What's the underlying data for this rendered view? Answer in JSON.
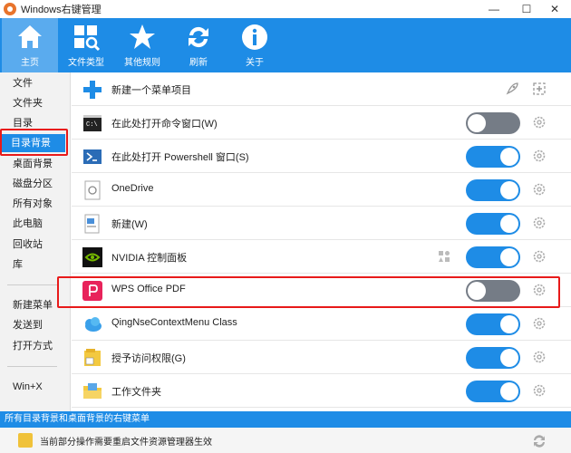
{
  "app": {
    "title": "Windows右键管理"
  },
  "window_controls": {
    "minimize": "—",
    "maximize": "☐",
    "close": "✕"
  },
  "toolbar": [
    {
      "name": "home",
      "label": "主页",
      "icon": "home-icon",
      "active": true
    },
    {
      "name": "file-types",
      "label": "文件类型",
      "icon": "file-types-icon",
      "active": false
    },
    {
      "name": "other-rules",
      "label": "其他规则",
      "icon": "star-icon",
      "active": false
    },
    {
      "name": "refresh",
      "label": "刷新",
      "icon": "refresh-icon",
      "active": false
    },
    {
      "name": "about",
      "label": "关于",
      "icon": "info-icon",
      "active": false
    }
  ],
  "sidebar": {
    "items": [
      {
        "label": "文件"
      },
      {
        "label": "文件夹"
      },
      {
        "label": "目录"
      },
      {
        "label": "目录背景",
        "selected": true
      },
      {
        "label": "桌面背景"
      },
      {
        "label": "磁盘分区"
      },
      {
        "label": "所有对象"
      },
      {
        "label": "此电脑"
      },
      {
        "label": "回收站"
      },
      {
        "label": "库"
      },
      {
        "label": "新建菜单"
      },
      {
        "label": "发送到"
      },
      {
        "label": "打开方式"
      },
      {
        "label": "Win+X"
      }
    ]
  },
  "main": {
    "new_item": {
      "label": "新建一个菜单项目"
    },
    "rows": [
      {
        "label": "在此处打开命令窗口(W)",
        "icon": "cmd-icon",
        "enabled": false
      },
      {
        "label": "在此处打开 Powershell 窗口(S)",
        "icon": "powershell-icon",
        "enabled": true
      },
      {
        "label": "OneDrive",
        "icon": "onedrive-icon",
        "enabled": true
      },
      {
        "label": "新建(W)",
        "icon": "new-icon",
        "enabled": true
      },
      {
        "label": "NVIDIA 控制面板",
        "icon": "nvidia-icon",
        "enabled": true,
        "extra_icon": true
      },
      {
        "label": "WPS Office PDF",
        "icon": "wps-pdf-icon",
        "enabled": false,
        "highlighted": true
      },
      {
        "label": "QingNseContextMenu Class",
        "icon": "cloud-icon",
        "enabled": true
      },
      {
        "label": "授予访问权限(G)",
        "icon": "share-icon",
        "enabled": true
      },
      {
        "label": "工作文件夹",
        "icon": "folder-icon",
        "enabled": true
      }
    ]
  },
  "status": {
    "text": "所有目录背景和桌面背景的右键菜单"
  },
  "notice": {
    "text": "当前部分操作需要重启文件资源管理器生效"
  },
  "colors": {
    "accent": "#1e8ce6",
    "toggle_off": "#757c86",
    "highlight": "#e81a1a"
  }
}
